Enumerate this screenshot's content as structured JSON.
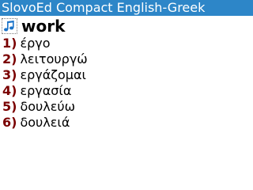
{
  "app": {
    "title": "SlovoEd Compact English-Greek",
    "title_bar_color": "#2d86c8",
    "accent_number_color": "#7a0000"
  },
  "entry": {
    "sound_icon": "music-note-icon",
    "headword": "work",
    "translations": [
      {
        "number": "1)",
        "text": "έργο"
      },
      {
        "number": "2)",
        "text": "λειτουργώ"
      },
      {
        "number": "3)",
        "text": "εργάζομαι"
      },
      {
        "number": "4)",
        "text": "εργασία"
      },
      {
        "number": "5)",
        "text": "δουλεύω"
      },
      {
        "number": "6)",
        "text": "δουλειά"
      }
    ]
  }
}
